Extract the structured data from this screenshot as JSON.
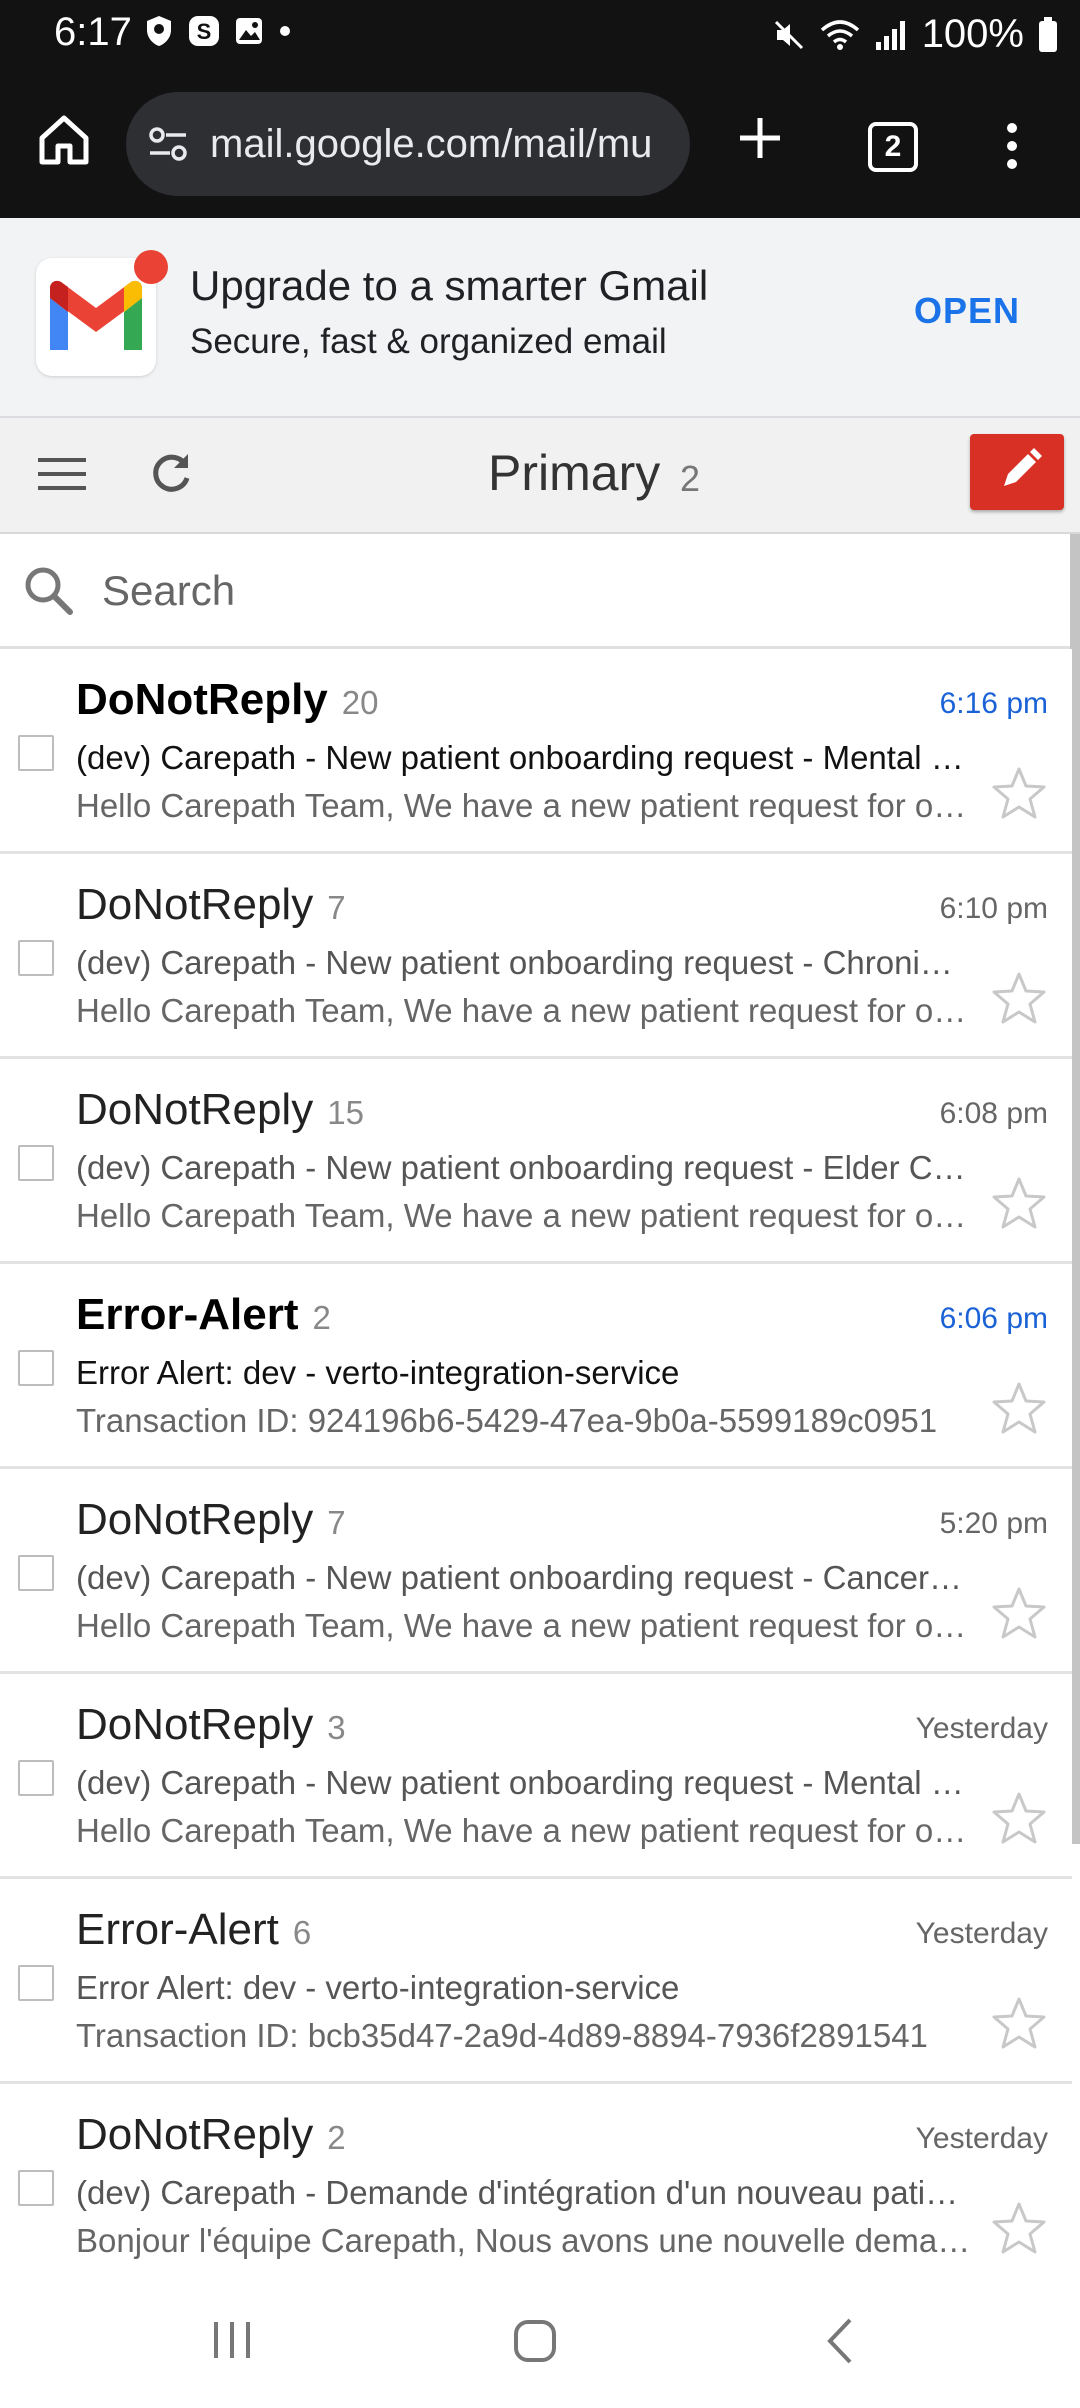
{
  "status_bar": {
    "time": "6:17",
    "battery": "100%",
    "left_icons": [
      "shield-icon",
      "s-app-icon",
      "gallery-icon",
      "dot-icon"
    ],
    "right_icons": [
      "mute-icon",
      "wifi-icon",
      "signal-icon",
      "battery-icon"
    ]
  },
  "browser": {
    "url": "mail.google.com/mail/mu",
    "tab_count": "2"
  },
  "promo": {
    "title": "Upgrade to a smarter Gmail",
    "subtitle": "Secure, fast & organized email",
    "open_label": "OPEN"
  },
  "header": {
    "title": "Primary",
    "count": "2"
  },
  "search": {
    "placeholder": "Search"
  },
  "colors": {
    "accent": "#1a73e8",
    "compose": "#d93025",
    "unread_time": "#1a62d6"
  },
  "mails": [
    {
      "sender": "DoNotReply",
      "count": "20",
      "time": "6:16 pm",
      "unread": true,
      "subject": "(dev) Carepath - New patient onboarding request - Mental Health",
      "snippet": "Hello Carepath Team, We have a new patient request for onboarding"
    },
    {
      "sender": "DoNotReply",
      "count": "7",
      "time": "6:10 pm",
      "unread": false,
      "subject": "(dev) Carepath - New patient onboarding request - Chronic Care",
      "snippet": "Hello Carepath Team, We have a new patient request for onboarding"
    },
    {
      "sender": "DoNotReply",
      "count": "15",
      "time": "6:08 pm",
      "unread": false,
      "subject": "(dev) Carepath - New patient onboarding request - Elder Care",
      "snippet": "Hello Carepath Team, We have a new patient request for onboarding"
    },
    {
      "sender": "Error-Alert",
      "count": "2",
      "time": "6:06 pm",
      "unread": true,
      "subject": "Error Alert: dev - verto-integration-service",
      "snippet": "Transaction ID: 924196b6-5429-47ea-9b0a-5599189c0951"
    },
    {
      "sender": "DoNotReply",
      "count": "7",
      "time": "5:20 pm",
      "unread": false,
      "subject": "(dev) Carepath - New patient onboarding request - Cancer Care",
      "snippet": "Hello Carepath Team, We have a new patient request for onboarding"
    },
    {
      "sender": "DoNotReply",
      "count": "3",
      "time": "Yesterday",
      "unread": false,
      "subject": "(dev) Carepath - New patient onboarding request - Mental Health",
      "snippet": "Hello Carepath Team, We have a new patient request for onboarding"
    },
    {
      "sender": "Error-Alert",
      "count": "6",
      "time": "Yesterday",
      "unread": false,
      "subject": "Error Alert: dev - verto-integration-service",
      "snippet": "Transaction ID: bcb35d47-2a9d-4d89-8894-7936f2891541"
    },
    {
      "sender": "DoNotReply",
      "count": "2",
      "time": "Yesterday",
      "unread": false,
      "subject": "(dev) Carepath - Demande d'intégration d'un nouveau patient",
      "snippet": "Bonjour l'équipe Carepath, Nous avons une nouvelle demande"
    }
  ]
}
